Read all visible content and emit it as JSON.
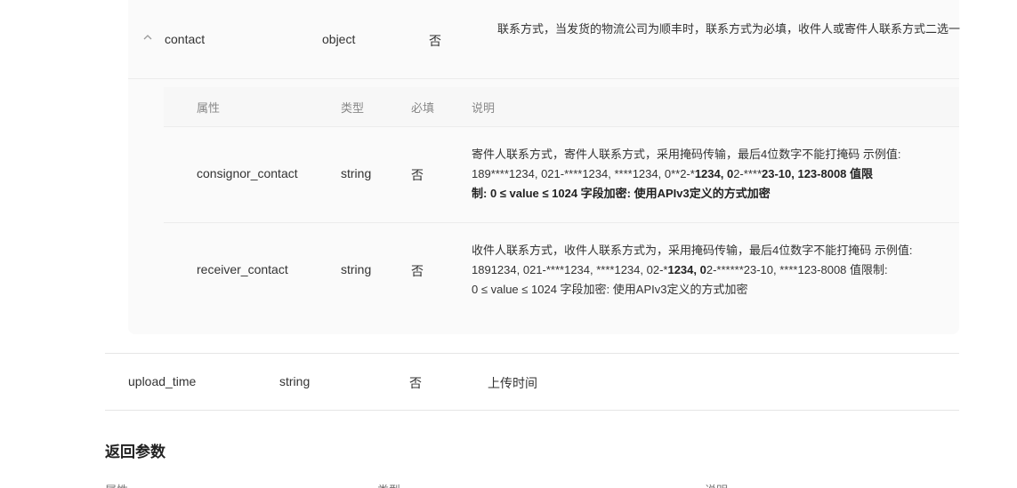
{
  "contact": {
    "chevron": "^",
    "name": "contact",
    "type": "object",
    "required": "否",
    "description": "联系方式，当发货的物流公司为顺丰时，联系方式为必填，收件人或寄件人联系方式二选一"
  },
  "inner_table": {
    "headers": {
      "name": "属性",
      "type": "类型",
      "required": "必填",
      "description": "说明"
    },
    "rows": [
      {
        "name": "consignor_contact",
        "type": "string",
        "required": "否",
        "desc_line1": "寄件人联系方式，寄件人联系方式，采用掩码传输，最后4位数字不能打掩码 示例值:",
        "desc_line2_plain": "189****1234, 021-****1234, ****1234, 0**2-*",
        "desc_line2_bold1": "1234, 0",
        "desc_line2_mid": "2-****",
        "desc_line2_bold2": "23-10, 123-8008 值限",
        "desc_line3_bold": "制: 0 ≤ value ≤ 1024 字段加密: 使用APIv3定义的方式加密"
      },
      {
        "name": "receiver_contact",
        "type": "string",
        "required": "否",
        "desc_line1": "收件人联系方式，收件人联系方式为，采用掩码传输，最后4位数字不能打掩码 示例值:",
        "desc_line2_plain": "1891234, 021-****1234, ****1234, 02-*",
        "desc_line2_bold1": "1234, 0",
        "desc_line2_mid": "2-******23-10, ****123-8008 值限制:",
        "desc_line3_plain": "0 ≤ value ≤ 1024 字段加密: 使用APIv3定义的方式加密"
      }
    ]
  },
  "upload_time_row": {
    "name": "upload_time",
    "type": "string",
    "required": "否",
    "description": "上传时间"
  },
  "return_section": {
    "title": "返回参数"
  }
}
